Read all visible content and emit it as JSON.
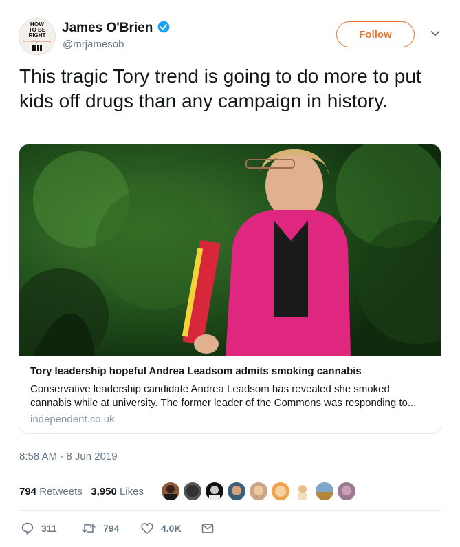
{
  "author": {
    "avatar_text": [
      "HOW",
      "TO BE",
      "RIGHT",
      "in a world gone wrong"
    ],
    "name": "James O'Brien",
    "handle": "@mrjamesob",
    "verified": true
  },
  "follow_label": "Follow",
  "tweet_text": "This tragic Tory trend is going to do more to put kids off drugs than any campaign in history.",
  "card": {
    "title": "Tory leadership hopeful Andrea Leadsom admits smoking cannabis",
    "description": "Conservative leadership candidate Andrea Leadsom has revealed she smoked cannabis while at university. The former leader of the Commons was responding to...",
    "domain": "independent.co.uk"
  },
  "timestamp": "8:58 AM - 8 Jun 2019",
  "stats": {
    "retweets_count": "794",
    "retweets_label": "Retweets",
    "likes_count": "3,950",
    "likes_label": "Likes"
  },
  "actions": {
    "reply_count": "311",
    "retweet_count": "794",
    "like_count": "4.0K"
  },
  "colors": {
    "accent": "#e0772c",
    "verified": "#1da1f2",
    "muted": "#657786"
  },
  "icons": [
    "verified-badge-icon",
    "chevron-down-icon",
    "reply-icon",
    "retweet-icon",
    "heart-icon",
    "direct-message-icon"
  ]
}
